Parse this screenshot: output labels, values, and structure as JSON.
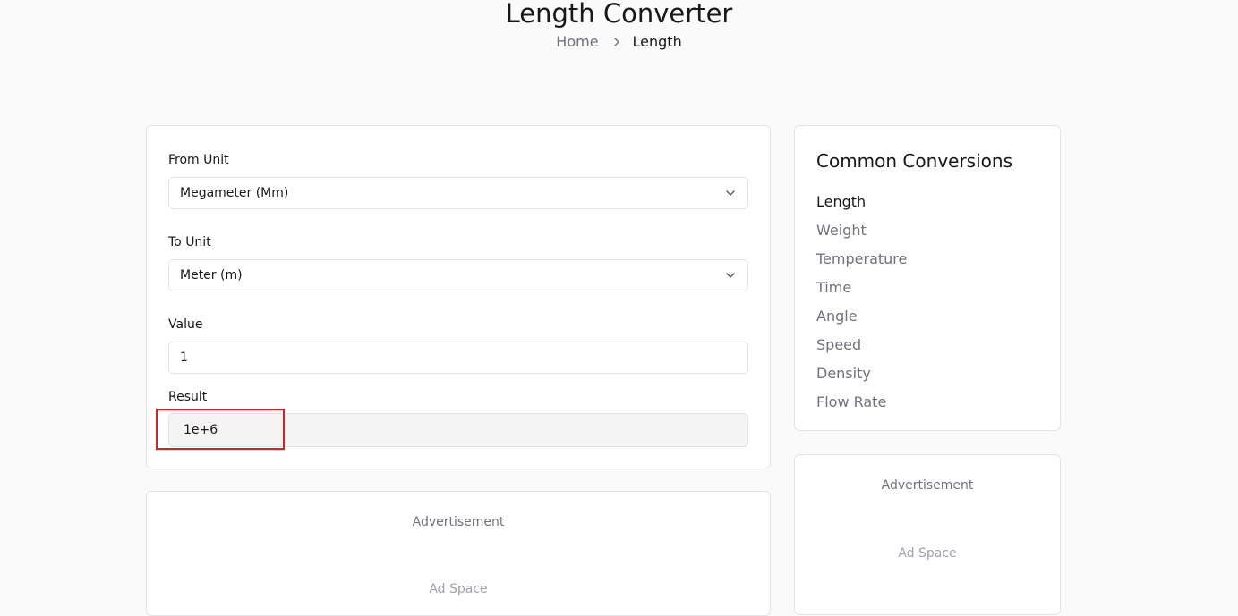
{
  "header": {
    "title": "Length Converter",
    "breadcrumb": {
      "home": "Home",
      "current": "Length"
    }
  },
  "converter": {
    "from_label": "From Unit",
    "from_value": "Megameter (Mm)",
    "to_label": "To Unit",
    "to_value": "Meter (m)",
    "value_label": "Value",
    "value": "1",
    "result_label": "Result",
    "result": "1e+6"
  },
  "sidebar": {
    "title": "Common Conversions",
    "items": [
      {
        "label": "Length",
        "active": true
      },
      {
        "label": "Weight",
        "active": false
      },
      {
        "label": "Temperature",
        "active": false
      },
      {
        "label": "Time",
        "active": false
      },
      {
        "label": "Angle",
        "active": false
      },
      {
        "label": "Speed",
        "active": false
      },
      {
        "label": "Density",
        "active": false
      },
      {
        "label": "Flow Rate",
        "active": false
      }
    ]
  },
  "ads": {
    "label": "Advertisement",
    "placeholder": "Ad Space"
  },
  "colors": {
    "highlight": "#e11d1d",
    "muted_text": "#71717a",
    "border": "#e4e4e7"
  }
}
